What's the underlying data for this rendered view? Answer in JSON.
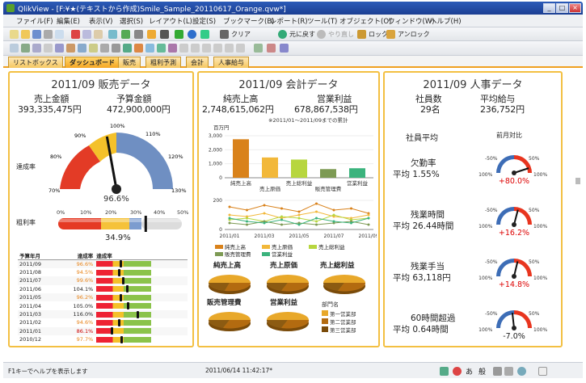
{
  "window": {
    "title": "QlikView - [F:¥★(テキストから作成)Smile_Sample_20110617_Orange.qvw*]",
    "controls": [
      "_",
      "□",
      "×"
    ]
  },
  "menu": [
    "ファイル(F)",
    "編集(E)",
    "表示(V)",
    "選択(S)",
    "レイアウト(L)",
    "設定(S)",
    "ブックマーク(B)",
    "レポート(R)",
    "ツール(T)",
    "オブジェクト(O)",
    "ウィンドウ(W)",
    "ヘルプ(H)"
  ],
  "toolbar": {
    "clear": "クリア",
    "back": "元に戻す",
    "redo": "やり直し",
    "lock": "ロック",
    "unlock": "アンロック"
  },
  "tabs": [
    "リストボックス",
    "ダッシュボード",
    "販売",
    "粗利予測",
    "会計",
    "人事給与"
  ],
  "active_tab": "ダッシュボード",
  "sales": {
    "title": "2011/09 販売データ",
    "sales_label": "売上金額",
    "sales_value": "393,335,475円",
    "budget_label": "予算金額",
    "budget_value": "472,900,000円",
    "achievement_label": "達成率",
    "gauge_ticks": [
      "70%",
      "80%",
      "90%",
      "100%",
      "110%",
      "120%",
      "130%"
    ],
    "gauge_value_text": "96.6%",
    "gauge_value": 0.966,
    "margin_label": "粗利率",
    "margin_ticks": [
      "0%",
      "10%",
      "20%",
      "30%",
      "40%",
      "50%"
    ],
    "margin_value_text": "34.9%",
    "margin_value": 0.349,
    "table_headers": [
      "予算年月",
      "達成率",
      "達成率"
    ],
    "table_rows": [
      {
        "month": "2011/09",
        "rate": "96.6%",
        "value": 0.966,
        "status": "org"
      },
      {
        "month": "2011/08",
        "rate": "94.5%",
        "value": 0.945,
        "status": "org"
      },
      {
        "month": "2011/07",
        "rate": "99.6%",
        "value": 0.996,
        "status": "org"
      },
      {
        "month": "2011/06",
        "rate": "104.1%",
        "value": 1.041,
        "status": "ok"
      },
      {
        "month": "2011/05",
        "rate": "96.2%",
        "value": 0.962,
        "status": "org"
      },
      {
        "month": "2011/04",
        "rate": "105.0%",
        "value": 1.05,
        "status": "ok"
      },
      {
        "month": "2011/03",
        "rate": "116.0%",
        "value": 1.16,
        "status": "ok"
      },
      {
        "month": "2011/02",
        "rate": "94.6%",
        "value": 0.946,
        "status": "org"
      },
      {
        "month": "2011/01",
        "rate": "86.1%",
        "value": 0.861,
        "status": "red"
      },
      {
        "month": "2010/12",
        "rate": "97.7%",
        "value": 0.977,
        "status": "org"
      }
    ]
  },
  "accounting": {
    "title": "2011/09 会計データ",
    "revenue_label": "純売上高",
    "revenue_value": "2,748,615,062円",
    "profit_label": "営業利益",
    "profit_value": "678,867,538円",
    "note": "※2011/01～2011/09までの累計",
    "unit": "百万円",
    "bar_categories": [
      "純売上高",
      "売上原価",
      "売上総利益",
      "販売管理費",
      "営業利益"
    ],
    "bar_values": [
      2750,
      1450,
      1300,
      620,
      680
    ],
    "bar_ticks": [
      "0",
      "1,000",
      "2,000",
      "3,000"
    ],
    "bar_colors": [
      "#d9821b",
      "#f2b83a",
      "#b7d63f",
      "#7d9a54",
      "#3bb37d"
    ],
    "line_ticks_y": [
      "0",
      "200"
    ],
    "line_x": [
      "2011/01",
      "2011/03",
      "2011/05",
      "2011/07",
      "2011/09"
    ],
    "legend": [
      "純売上高",
      "売上原価",
      "売上総利益",
      "販売管理費",
      "営業利益"
    ],
    "pies": [
      "純売上高",
      "売上原価",
      "売上総利益",
      "販売管理費",
      "営業利益"
    ],
    "dept_title": "部門名",
    "depts": [
      "第一営業部",
      "第二営業部",
      "第三営業部"
    ],
    "dept_colors": [
      "#e8a82a",
      "#b36b10",
      "#7a4b0a"
    ]
  },
  "hr": {
    "title": "2011/09 人事データ",
    "headcount_label": "社員数",
    "headcount_value": "29名",
    "salary_label": "平均給与",
    "salary_value": "236,752円",
    "avg_label": "社員平均",
    "compare_label": "前月対比",
    "metrics": [
      {
        "name": "欠勤率",
        "value": "平均 1.55%",
        "change": "+80.0%",
        "change_color": "#dd0000",
        "needle": 0.8
      },
      {
        "name": "残業時間",
        "value": "平均 26.44時間",
        "change": "+16.2%",
        "change_color": "#dd0000",
        "needle": 0.162
      },
      {
        "name": "業手当",
        "prefix": "残",
        "value": "平均 63,118円",
        "change": "+14.8%",
        "change_color": "#dd0000",
        "needle": 0.148
      },
      {
        "name": "60時間超過",
        "value": "平均 0.64時間",
        "change": "-7.0%",
        "change_color": "#222222",
        "needle": -0.07
      }
    ],
    "mini_ticks": [
      "-50%",
      "50%",
      "-100%",
      "100%"
    ]
  },
  "status": {
    "help": "F1キーでヘルプを表示します",
    "timestamp": "2011/06/14 11:42:17*"
  }
}
